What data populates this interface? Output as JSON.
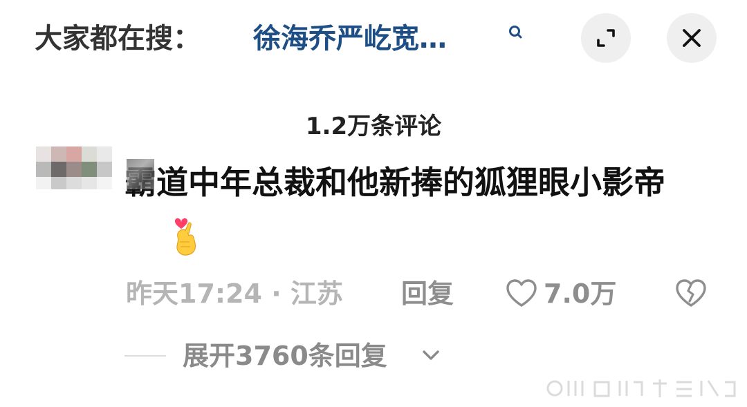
{
  "topbar": {
    "search_prefix": "大家都在搜：",
    "search_query": "徐海乔严屹宽…",
    "expand_icon": "expand-icon",
    "close_icon": "close-icon",
    "search_icon": "search-icon"
  },
  "comments": {
    "count_label": "1.2万条评论"
  },
  "comment": {
    "text": "霸道中年总裁和他新捧的狐狸眼小影帝",
    "emoji": "finger-heart-emoji",
    "meta": "昨天17:24 · 江苏",
    "reply_label": "回复",
    "like_count": "7.0万",
    "expand_replies_label": "展开3760条回复"
  },
  "colors": {
    "query_link": "#1d4f86",
    "muted_text": "#8e8e8e",
    "time_text": "#b5b5b5",
    "button_bg": "#efefef"
  }
}
